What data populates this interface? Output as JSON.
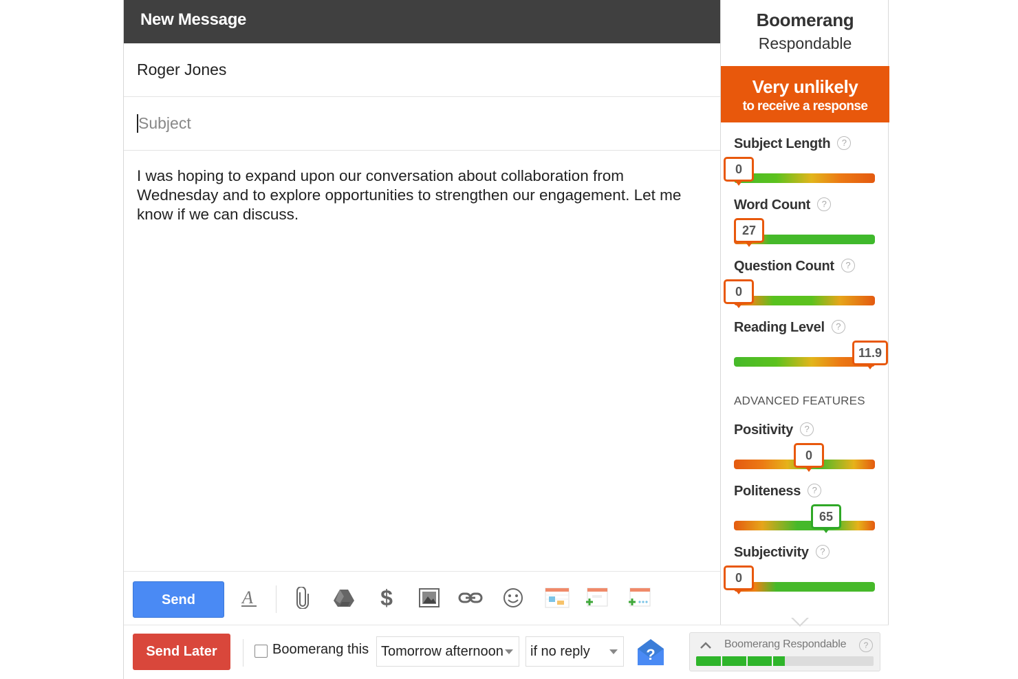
{
  "compose": {
    "title": "New Message",
    "to_value": "Roger Jones",
    "subject_placeholder": "Subject",
    "body": "I was hoping to expand upon our conversation about collaboration from Wednesday and to explore opportunities to strengthen our engagement. Let me know if we can discuss.",
    "send_label": "Send",
    "toolbar_icons": [
      "text-format-icon",
      "paperclip-icon",
      "drive-icon",
      "dollar-icon",
      "insert-photo-icon",
      "link-icon",
      "emoji-icon",
      "calendar-insert-icon",
      "calendar-add-icon",
      "calendar-more-icon"
    ]
  },
  "bottombar": {
    "send_later_label": "Send Later",
    "boomerang_checkbox_label": "Boomerang this",
    "boomerang_checked": false,
    "when_value": "Tomorrow afternoon",
    "condition_value": "if no reply",
    "help_icon": "help-envelope-icon",
    "respondable_label": "Boomerang Respondable",
    "respondable_level": 0.5
  },
  "panel": {
    "title": "Boomerang",
    "subtitle": "Respondable",
    "verdict_main": "Very unlikely",
    "verdict_sub": "to receive a response",
    "verdict_color": "#e8580c",
    "metrics": [
      {
        "label": "Subject Length",
        "value": "0"
      },
      {
        "label": "Word Count",
        "value": "27"
      },
      {
        "label": "Question Count",
        "value": "0"
      },
      {
        "label": "Reading Level",
        "value": "11.9"
      }
    ],
    "advanced_heading": "ADVANCED FEATURES",
    "advanced": [
      {
        "label": "Positivity",
        "value": "0"
      },
      {
        "label": "Politeness",
        "value": "65"
      },
      {
        "label": "Subjectivity",
        "value": "0"
      }
    ]
  },
  "colors": {
    "send_blue": "#4a8af4",
    "send_later_red": "#d9473b",
    "titlebar": "#404040",
    "bad_orange": "#e8580c",
    "good_green": "#2fa827"
  }
}
